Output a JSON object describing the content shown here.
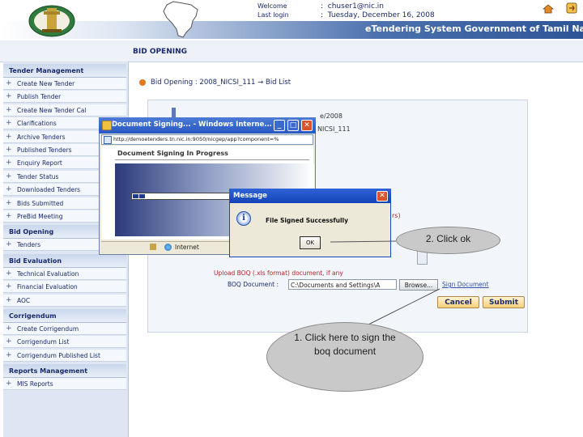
{
  "header": {
    "welcome_label": "Welcome",
    "welcome_sep": ":",
    "welcome_value": "chuser1@nic.in",
    "lastlogin_label": "Last login",
    "lastlogin_value": "Tuesday, December 16, 2008",
    "system_title": "eTendering System Government of Tamil Na",
    "icons": [
      "emblem-logo",
      "tamil-nadu-map",
      "home-icon",
      "logout-icon"
    ]
  },
  "page": {
    "title": "BID OPENING",
    "breadcrumb": "Bid Opening : 2008_NICSI_111 → Bid List"
  },
  "sidebar": {
    "sections": [
      {
        "label": "Tender Management",
        "items": [
          "Create New Tender",
          "Publish Tender",
          "Create New Tender Cal",
          "Clarifications",
          "Archive Tenders",
          "Published Tenders",
          "Enquiry Report",
          "Tender Status",
          "Downloaded Tenders",
          "Bids Submitted",
          "PreBid Meeting"
        ]
      },
      {
        "label": "Bid Opening",
        "items": [
          "Tenders"
        ]
      },
      {
        "label": "Bid Evaluation",
        "items": [
          "Technical Evaluation",
          "Financial Evaluation",
          "AOC"
        ]
      },
      {
        "label": "Corrigendum",
        "items": [
          "Create Corrigendum",
          "Corrigendum List",
          "Corrigendum Published List"
        ]
      },
      {
        "label": "Reports Management",
        "items": [
          "MIS Reports"
        ]
      }
    ]
  },
  "main": {
    "date_fragment": "e/2008",
    "nic_fragment": "NICSI_111",
    "note_fragment": "rs)",
    "upload_note": "Upload BOQ (.xls format) document, if any",
    "boq_label": "BOQ Document :",
    "boq_value": "C:\\Documents and Settings\\A",
    "browse_label": "Browse...",
    "sign_link": "Sign Document",
    "cancel_label": "Cancel",
    "submit_label": "Submit"
  },
  "popup": {
    "title": "Document Signing... - Windows Interne...",
    "address": "http://demoetenders.tn.nic.in:9050/nicgep/app?component=%",
    "heading": "Document Signing In Progress",
    "status_zone": "Internet",
    "min_glyph": "_",
    "max_glyph": "□",
    "close_glyph": "✕"
  },
  "dialog": {
    "title": "Message",
    "message": "File Signed Successfully",
    "ok_label": "OK",
    "info_glyph": "i",
    "close_glyph": "✕"
  },
  "callouts": {
    "ok_note": "2. Click ok",
    "sign_note": "1. Click here to sign the boq document"
  },
  "colors": {
    "navy_text": "#1a2a6c",
    "title_bar": "#2657c4",
    "accent_orange": "#e07b1f",
    "button_gold": "#f4cf7a"
  }
}
